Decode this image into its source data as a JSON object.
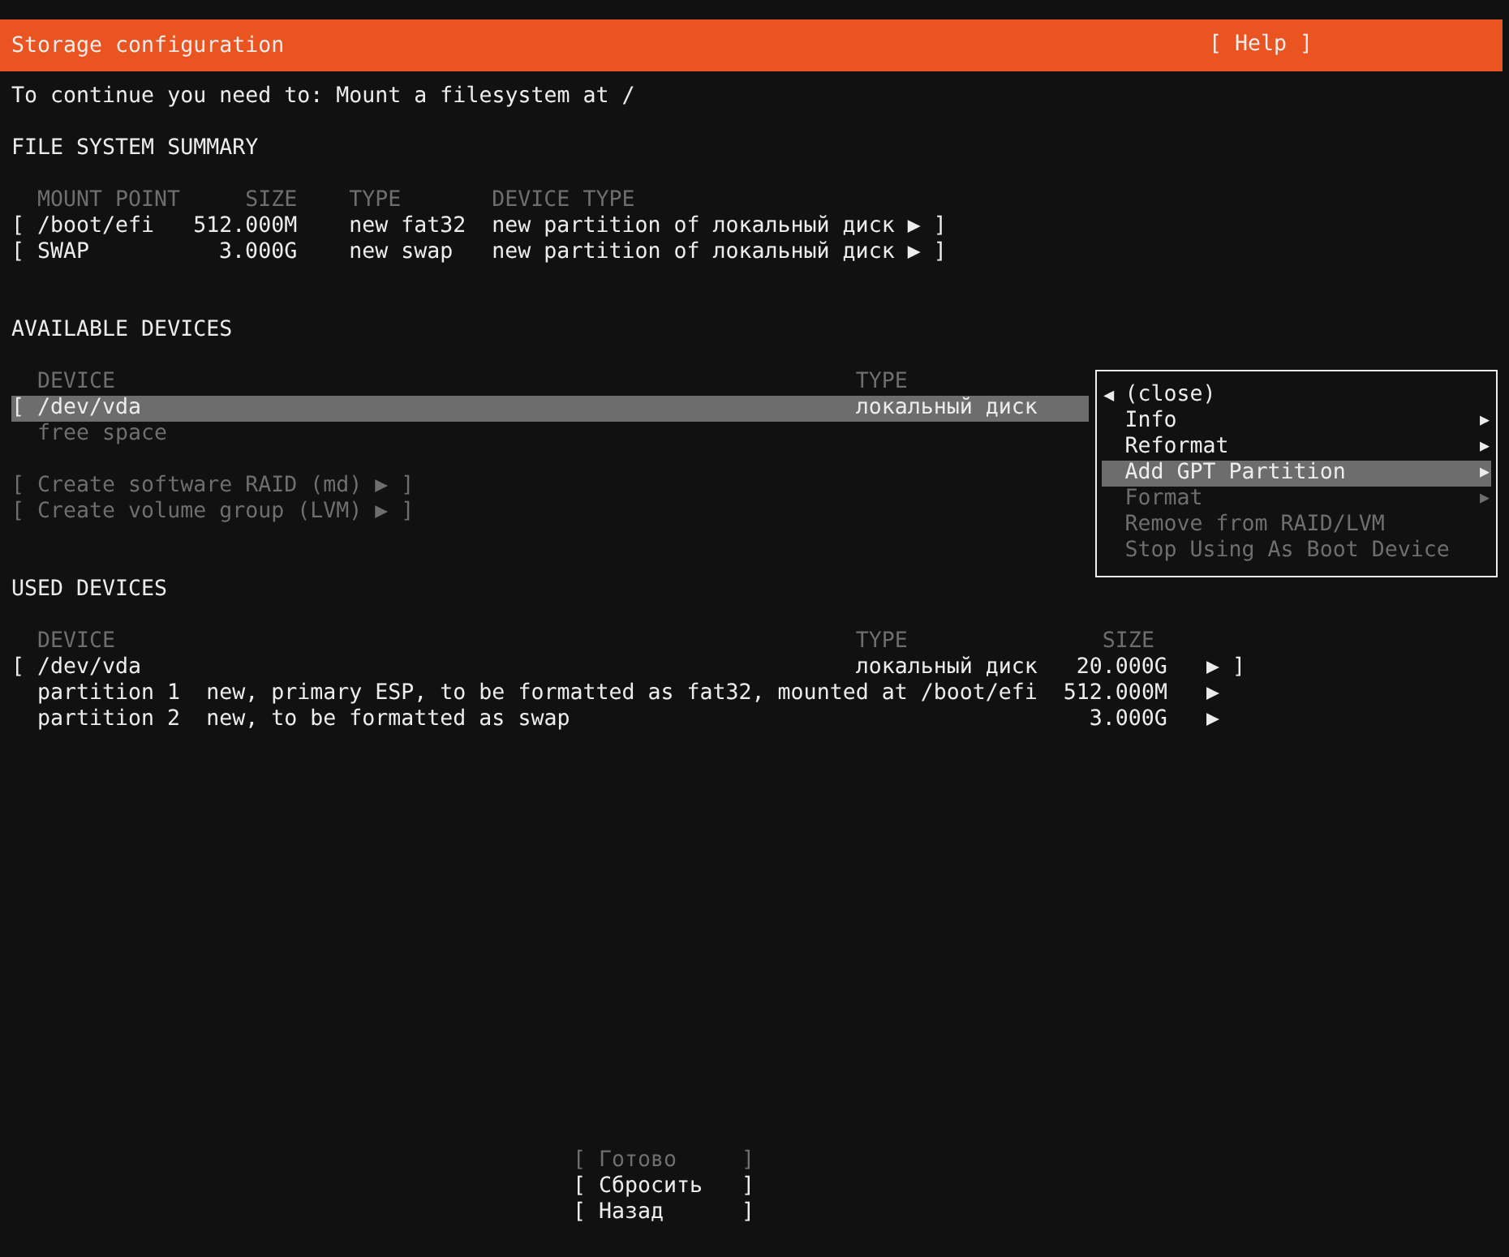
{
  "header": {
    "title": "Storage configuration",
    "help": "[ Help ]"
  },
  "message": "To continue you need to: Mount a filesystem at /",
  "file_system_summary": {
    "title": "FILE SYSTEM SUMMARY",
    "columns": [
      "MOUNT POINT",
      "SIZE",
      "TYPE",
      "DEVICE TYPE"
    ],
    "rows": [
      {
        "open": "[",
        "mount_point": "/boot/efi",
        "size": "512.000M",
        "type": "new fat32",
        "device_type": "new partition of локальный диск",
        "arrow": "▶",
        "close": "]"
      },
      {
        "open": "[",
        "mount_point": "SWAP",
        "size": "3.000G",
        "type": "new swap",
        "device_type": "new partition of локальный диск",
        "arrow": "▶",
        "close": "]"
      }
    ]
  },
  "available_devices": {
    "title": "AVAILABLE DEVICES",
    "columns": [
      "DEVICE",
      "TYPE"
    ],
    "rows": [
      {
        "kind": "device",
        "open": "[",
        "device": "/dev/vda",
        "type": "локальный диск",
        "selected": true,
        "disabled": false
      },
      {
        "kind": "free",
        "device": "free space",
        "selected": false,
        "disabled": true
      }
    ],
    "actions": [
      {
        "open": "[",
        "label": "Create software RAID (md)",
        "arrow": "▶",
        "close": "]",
        "disabled": true
      },
      {
        "open": "[",
        "label": "Create volume group (LVM)",
        "arrow": "▶",
        "close": "]",
        "disabled": true
      }
    ]
  },
  "context_menu": {
    "items": [
      {
        "kind": "close",
        "lead": "◀",
        "label": "(close)",
        "selected": false,
        "disabled": false
      },
      {
        "kind": "submenu",
        "label": "Info",
        "arrow": "▶",
        "selected": false,
        "disabled": false
      },
      {
        "kind": "submenu",
        "label": "Reformat",
        "arrow": "▶",
        "selected": false,
        "disabled": false
      },
      {
        "kind": "submenu",
        "label": "Add GPT Partition",
        "arrow": "▶",
        "selected": true,
        "disabled": false
      },
      {
        "kind": "submenu",
        "label": "Format",
        "arrow": "▶",
        "selected": false,
        "disabled": true
      },
      {
        "kind": "action",
        "label": "Remove from RAID/LVM",
        "selected": false,
        "disabled": true
      },
      {
        "kind": "action",
        "label": "Stop Using As Boot Device",
        "selected": false,
        "disabled": true
      }
    ]
  },
  "used_devices": {
    "title": "USED DEVICES",
    "columns": [
      "DEVICE",
      "TYPE",
      "SIZE"
    ],
    "rows": [
      {
        "kind": "device",
        "open": "[",
        "device": "/dev/vda",
        "type": "локальный диск",
        "size": "20.000G",
        "arrow": "▶",
        "close": "]"
      },
      {
        "kind": "partition",
        "device": "partition 1",
        "description": "new, primary ESP, to be formatted as fat32, mounted at /boot/efi",
        "size": "512.000M",
        "arrow": "▶"
      },
      {
        "kind": "partition",
        "device": "partition 2",
        "description": "new, to be formatted as swap",
        "size": "3.000G",
        "arrow": "▶"
      }
    ]
  },
  "buttons": [
    {
      "open": "[",
      "label": "Готово",
      "close": "]",
      "disabled": true
    },
    {
      "open": "[",
      "label": "Сбросить",
      "close": "]",
      "disabled": false
    },
    {
      "open": "[",
      "label": "Назад",
      "close": "]",
      "disabled": false
    }
  ]
}
